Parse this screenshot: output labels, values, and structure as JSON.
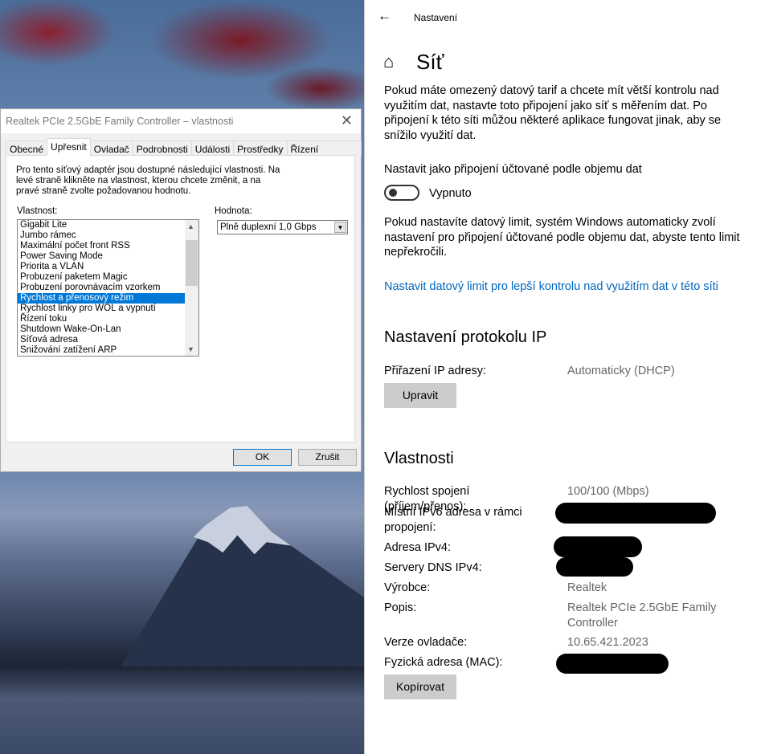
{
  "dialog": {
    "title": "Realtek PCIe 2.5GbE Family Controller – vlastnosti",
    "tabs": [
      "Obecné",
      "Upřesnit",
      "Ovladač",
      "Podrobnosti",
      "Události",
      "Prostředky",
      "Řízení spotřeby"
    ],
    "intro": "Pro tento síťový adaptér jsou dostupné následující vlastnosti. Na levé straně klikněte na vlastnost, kterou chcete změnit, a na pravé straně zvolte požadovanou hodnotu.",
    "property_label": "Vlastnost:",
    "value_label": "Hodnota:",
    "properties": [
      "Gigabit Lite",
      "Jumbo rámec",
      "Maximální počet front RSS",
      "Power Saving Mode",
      "Priorita a VLAN",
      "Probuzení paketem Magic",
      "Probuzení porovnávacím vzorkem",
      "Rychlost a přenosový režim",
      "Rychlost linky pro WOL a vypnutí",
      "Řízení toku",
      "Shutdown Wake-On-Lan",
      "Síťová adresa",
      "Snižování zatížení ARP"
    ],
    "selected_index": 7,
    "value": "Plně duplexní 1,0 Gbps",
    "ok": "OK",
    "cancel": "Zrušit"
  },
  "settings": {
    "app": "Nastavení",
    "title": "Síť",
    "metered_desc": "Pokud máte omezený datový tarif a chcete mít větší kontrolu nad využitím dat, nastavte toto připojení jako síť s měřením dat. Po připojení k této síti můžou některé aplikace fungovat jinak, aby se snížilo využití dat.",
    "metered_label": "Nastavit jako připojení účtované podle objemu dat",
    "toggle_state": "Vypnuto",
    "limit_desc": "Pokud nastavíte datový limit, systém Windows automaticky zvolí nastavení pro připojení účtované podle objemu dat, abyste tento limit nepřekročili.",
    "limit_link": "Nastavit datový limit pro lepší kontrolu nad využitím dat v této síti",
    "ip_heading": "Nastavení protokolu IP",
    "ip_assign_label": "Přiřazení IP adresy:",
    "ip_assign_value": "Automaticky (DHCP)",
    "edit": "Upravit",
    "props_heading": "Vlastnosti",
    "props": [
      {
        "label": "Rychlost spojení (příjem/přenos):",
        "value": "100/100 (Mbps)"
      },
      {
        "label": "Místní IPv6 adresa v rámci propojení:",
        "value": ""
      },
      {
        "label": "Adresa IPv4:",
        "value": ""
      },
      {
        "label": "Servery DNS IPv4:",
        "value": ""
      },
      {
        "label": "Výrobce:",
        "value": "Realtek"
      },
      {
        "label": "Popis:",
        "value": "Realtek PCIe 2.5GbE Family Controller"
      },
      {
        "label": "Verze ovladače:",
        "value": "10.65.421.2023"
      },
      {
        "label": "Fyzická adresa (MAC):",
        "value": ""
      }
    ],
    "copy": "Kopírovat"
  }
}
